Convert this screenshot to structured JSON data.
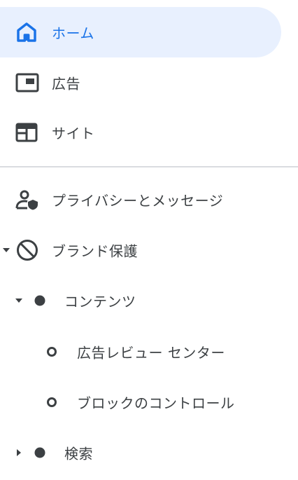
{
  "nav": {
    "items": [
      {
        "label": "ホーム",
        "icon": "home-icon"
      },
      {
        "label": "広告",
        "icon": "ad-unit-icon"
      },
      {
        "label": "サイト",
        "icon": "web-layout-icon"
      }
    ],
    "sub_items": [
      {
        "label": "プライバシーとメッセージ",
        "icon": "person-shield-icon"
      },
      {
        "label": "ブランド保護",
        "icon": "block-icon",
        "expanded": true
      },
      {
        "label": "コンテンツ",
        "icon": "filled-dot-icon",
        "expanded": true
      },
      {
        "label": "広告レビュー センター",
        "icon": "hollow-dot-icon"
      },
      {
        "label": "ブロックのコントロール",
        "icon": "hollow-dot-icon"
      },
      {
        "label": "検索",
        "icon": "filled-dot-icon",
        "expanded": false
      }
    ]
  },
  "colors": {
    "active_text": "#1a73e8",
    "active_bg": "#e8f0fe",
    "text": "#3c4043",
    "divider": "#dadce0"
  }
}
